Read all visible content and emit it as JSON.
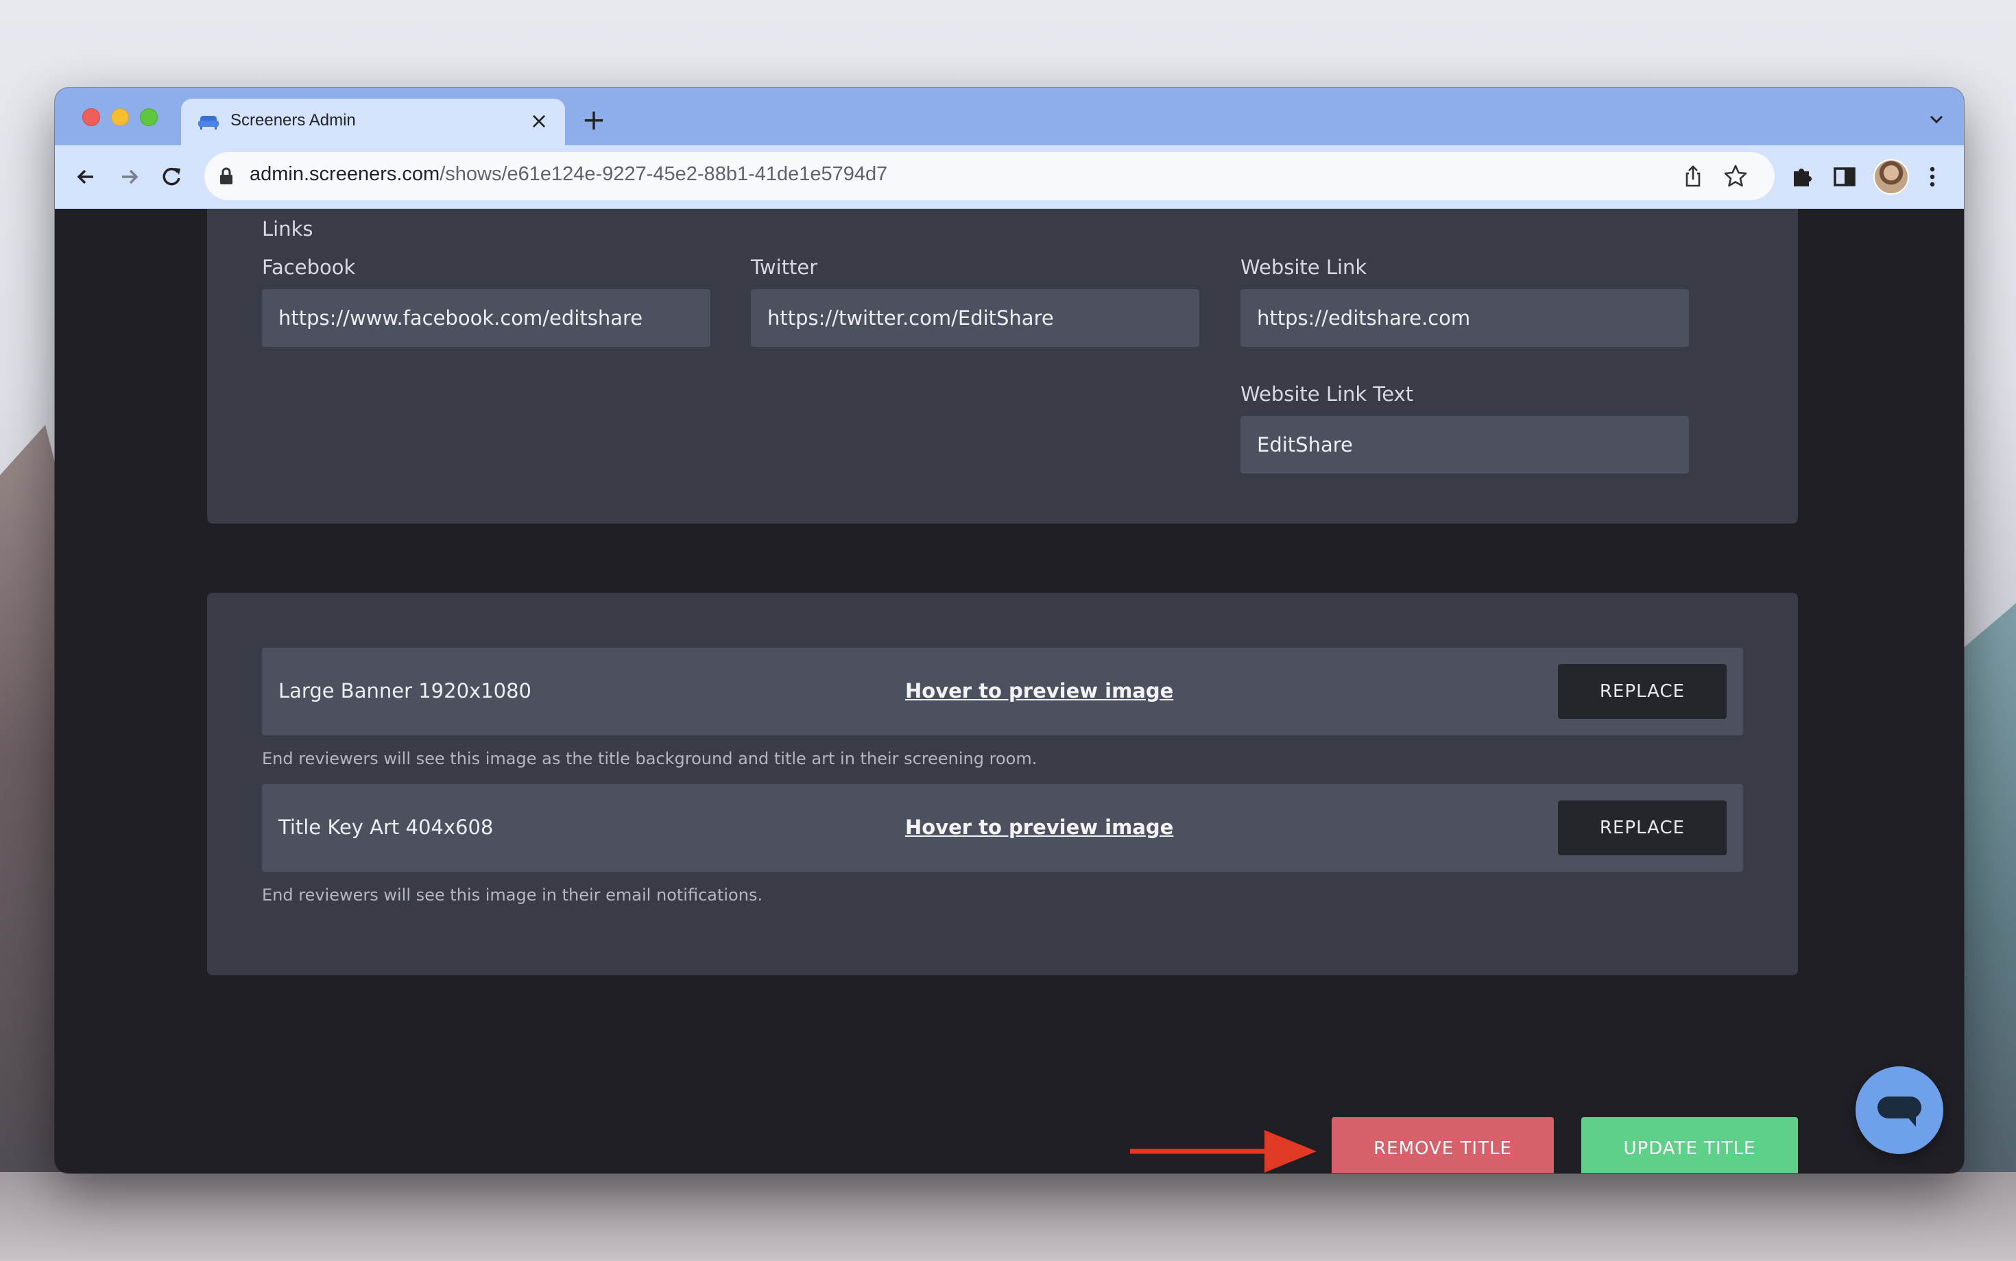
{
  "browser": {
    "tab_title": "Screeners Admin",
    "tab_close": "×",
    "new_tab": "+",
    "url_domain": "admin.screeners.com",
    "url_path": "/shows/e61e124e-9227-45e2-88b1-41de1e5794d7"
  },
  "links_section": {
    "heading": "Links",
    "facebook": {
      "label": "Facebook",
      "value": "https://www.facebook.com/editshare"
    },
    "twitter": {
      "label": "Twitter",
      "value": "https://twitter.com/EditShare"
    },
    "website": {
      "label": "Website Link",
      "value": "https://editshare.com"
    },
    "website_text": {
      "label": "Website Link Text",
      "value": "EditShare"
    }
  },
  "images_section": {
    "items": [
      {
        "name": "Large Banner 1920x1080",
        "preview_link": "Hover to preview image",
        "button": "REPLACE",
        "help": "End reviewers will see this image as the title background and title art in their screening room."
      },
      {
        "name": "Title Key Art 404x608",
        "preview_link": "Hover to preview image",
        "button": "REPLACE",
        "help": "End reviewers will see this image in their email notifications."
      }
    ]
  },
  "actions": {
    "remove_title": "REMOVE TITLE",
    "update_title": "UPDATE TITLE"
  },
  "colors": {
    "remove_button": "#d7616b",
    "update_button": "#5ed08a",
    "annotation_arrow": "#e03a24",
    "chat_bubble": "#6fa0ea"
  },
  "icons": [
    "back-arrow-icon",
    "forward-arrow-icon",
    "reload-icon",
    "lock-icon",
    "share-icon",
    "star-icon",
    "extensions-puzzle-icon",
    "side-panel-icon",
    "profile-avatar",
    "kebab-menu-icon",
    "chat-icon"
  ]
}
